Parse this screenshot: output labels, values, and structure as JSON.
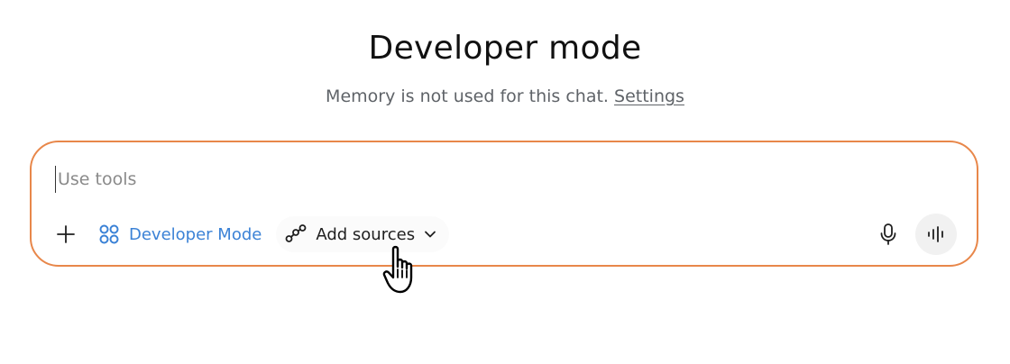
{
  "header": {
    "title": "Developer mode",
    "subtitle_text": "Memory is not used for this chat.",
    "settings_link": "Settings"
  },
  "composer": {
    "placeholder": "Use tools",
    "border_color": "#e8874a",
    "toolbar": {
      "plus_icon": "plus-icon",
      "developer_mode_label": "Developer Mode",
      "developer_mode_icon": "developer-mode-icon",
      "developer_mode_color": "#3b82d6",
      "add_sources_label": "Add sources",
      "add_sources_icon": "sources-icon",
      "dropdown_icon": "chevron-down-icon",
      "mic_icon": "microphone-icon",
      "voice_icon": "voice-waveform-icon"
    }
  },
  "cursor": {
    "icon": "hand-pointer-cursor-icon"
  }
}
